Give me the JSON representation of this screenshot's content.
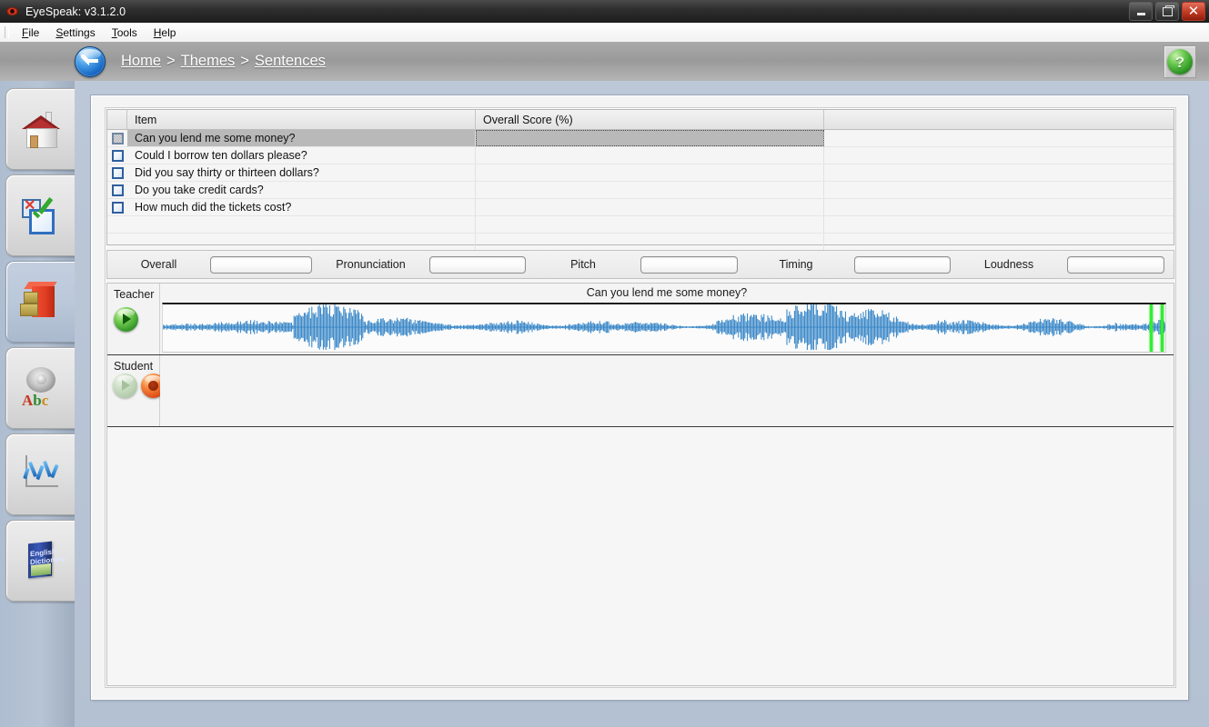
{
  "window": {
    "title": "EyeSpeak: v3.1.2.0",
    "app_icon": "eye-icon",
    "controls": {
      "minimize": "minimize-icon",
      "restore": "restore-icon",
      "close": "close-icon"
    }
  },
  "menu": {
    "items": [
      {
        "label": "File",
        "mnemonic": "F"
      },
      {
        "label": "Settings",
        "mnemonic": "S"
      },
      {
        "label": "Tools",
        "mnemonic": "T"
      },
      {
        "label": "Help",
        "mnemonic": "H"
      }
    ]
  },
  "header": {
    "back_icon": "back-arrow-icon",
    "help_icon": "help-question-icon",
    "help_label": "?",
    "breadcrumb": [
      {
        "label": "Home"
      },
      {
        "label": "Themes"
      },
      {
        "label": "Sentences"
      }
    ],
    "breadcrumb_separator": ">"
  },
  "sidebar": {
    "items": [
      {
        "name": "home",
        "icon": "house-icon",
        "active": false
      },
      {
        "name": "tests",
        "icon": "checkbox-tick-icon",
        "active": false
      },
      {
        "name": "themes",
        "icon": "filing-cabinet-icon",
        "active": true
      },
      {
        "name": "pronunciation",
        "icon": "speaker-abc-icon",
        "label": "Abc",
        "active": false
      },
      {
        "name": "progress",
        "icon": "zigzag-chart-icon",
        "active": false
      },
      {
        "name": "dictionary",
        "icon": "english-dictionary-book-icon",
        "label": "English Dictionary",
        "active": false
      }
    ]
  },
  "table": {
    "columns": [
      "",
      "Item",
      "Overall Score (%)",
      ""
    ],
    "rows": [
      {
        "item": "Can you lend me some money?",
        "score": "",
        "checked": false,
        "selected": true
      },
      {
        "item": "Could I borrow ten dollars please?",
        "score": "",
        "checked": false,
        "selected": false
      },
      {
        "item": "Did you say thirty or thirteen dollars?",
        "score": "",
        "checked": false,
        "selected": false
      },
      {
        "item": "Do you take credit cards?",
        "score": "",
        "checked": false,
        "selected": false
      },
      {
        "item": "How much did the tickets cost?",
        "score": "",
        "checked": false,
        "selected": false
      }
    ]
  },
  "scores": [
    {
      "label": "Overall",
      "value": ""
    },
    {
      "label": "Pronunciation",
      "value": ""
    },
    {
      "label": "Pitch",
      "value": ""
    },
    {
      "label": "Timing",
      "value": ""
    },
    {
      "label": "Loudness",
      "value": ""
    }
  ],
  "audio": {
    "teacher": {
      "label": "Teacher",
      "sentence": "Can you lend me some money?",
      "play_icon": "play-icon",
      "play_enabled": true
    },
    "student": {
      "label": "Student",
      "play_icon": "play-icon",
      "play_enabled": false,
      "record_icon": "record-icon"
    }
  },
  "colors": {
    "accent_blue": "#1668c4",
    "waveform": "#2b7fc4",
    "marker_green": "#2ff02f",
    "record_orange": "#e2531b",
    "page_bg": "#b9c5d6"
  }
}
